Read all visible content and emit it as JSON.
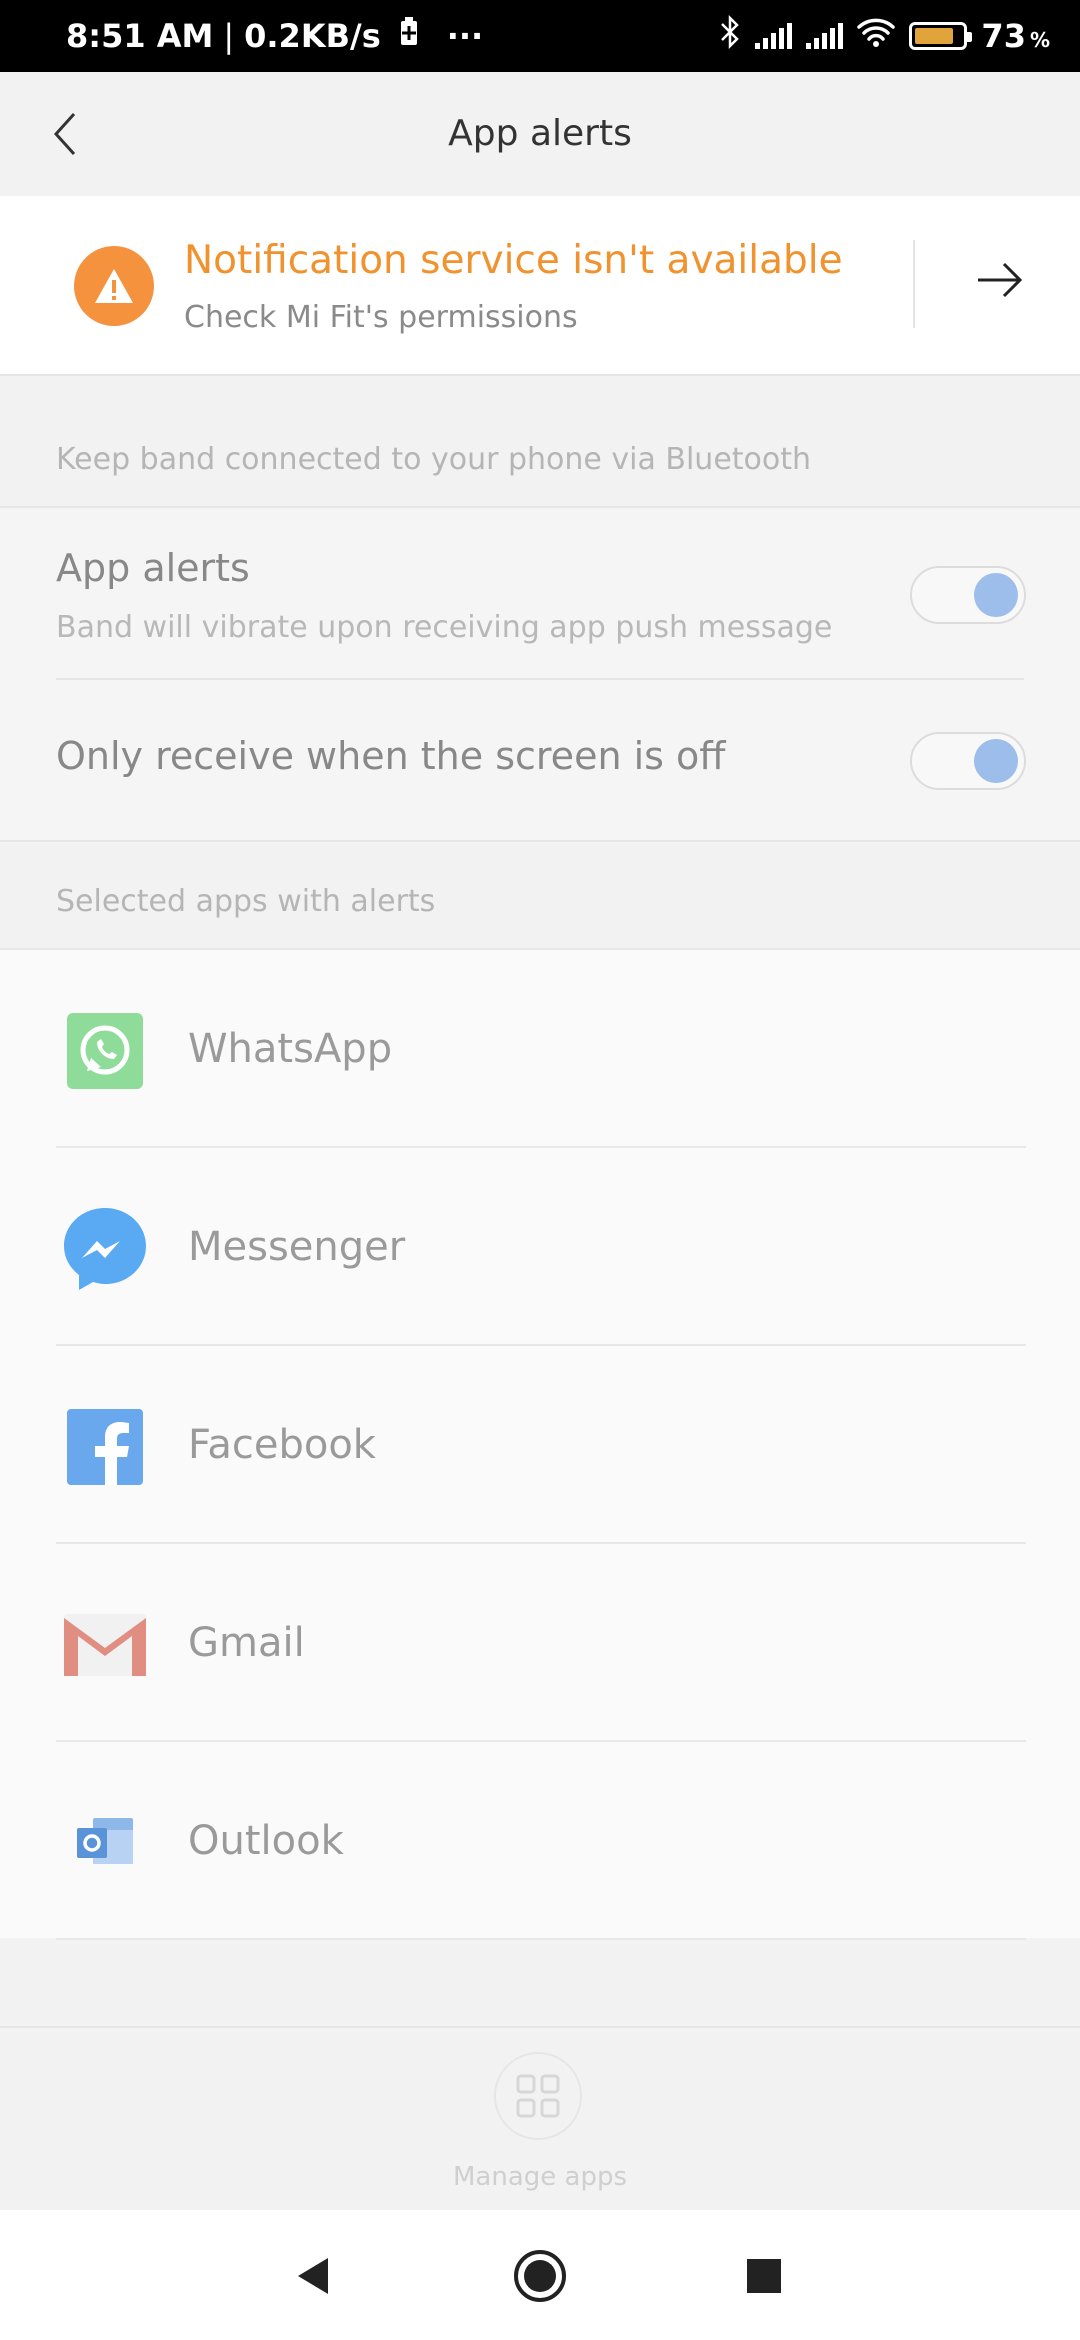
{
  "status_bar": {
    "time": "8:51 AM",
    "separator": "|",
    "speed": "0.2KB/s",
    "more": "···",
    "battery_level": "73",
    "battery_unit": "%"
  },
  "header": {
    "title": "App alerts",
    "back_icon": "chevron-left-icon"
  },
  "notice": {
    "title": "Notification service isn't available",
    "subtitle": "Check Mi Fit's permissions",
    "icon": "warning-icon",
    "action_icon": "arrow-right-icon"
  },
  "bluetooth_hint": "Keep band connected to your phone via Bluetooth",
  "settings": {
    "app_alerts": {
      "title": "App alerts",
      "subtitle": "Band will vibrate upon receiving app push message",
      "enabled": true
    },
    "screen_off": {
      "title": "Only receive when the screen is off",
      "enabled": true
    }
  },
  "apps_section_label": "Selected apps with alerts",
  "apps": [
    {
      "name": "WhatsApp",
      "icon": "whatsapp-icon"
    },
    {
      "name": "Messenger",
      "icon": "messenger-icon"
    },
    {
      "name": "Facebook",
      "icon": "facebook-icon"
    },
    {
      "name": "Gmail",
      "icon": "gmail-icon"
    },
    {
      "name": "Outlook",
      "icon": "outlook-icon"
    }
  ],
  "manage_apps": {
    "label": "Manage apps",
    "icon": "grid-icon"
  },
  "colors": {
    "accent_orange": "#f0922e",
    "toggle_knob": "#9dbdeb",
    "whatsapp": "#8fdc9a",
    "messenger": "#5aa9f3",
    "facebook": "#6aa8ee",
    "gmail": "#e08d82",
    "outlook": "#5b93d8"
  }
}
